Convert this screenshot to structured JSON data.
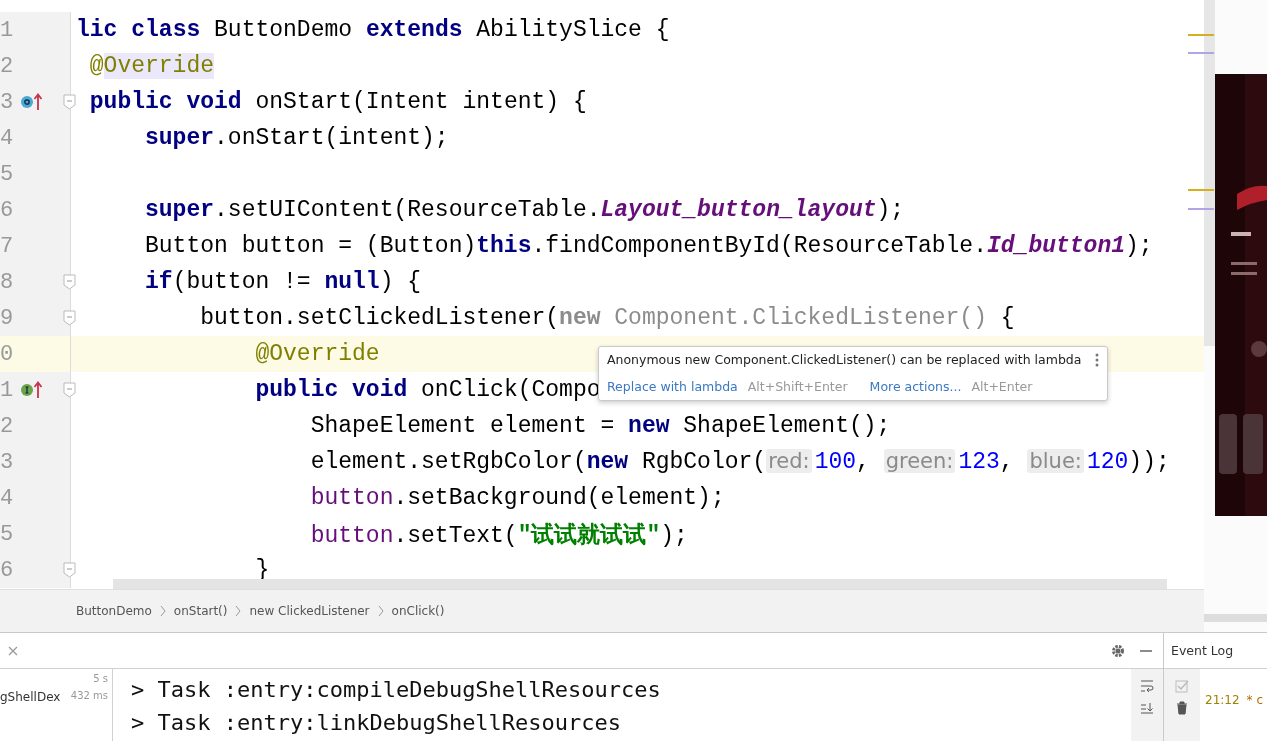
{
  "editor": {
    "lines": [
      {
        "number": "1",
        "kind": "plain",
        "fold": false,
        "current": false,
        "tokens": [
          {
            "t": "lic ",
            "kind": "kw"
          },
          {
            "t": "class ",
            "kind": "kw"
          },
          {
            "t": "ButtonDemo ",
            "kind": "plain"
          },
          {
            "t": "extends ",
            "kind": "kw"
          },
          {
            "t": "AbilitySlice {",
            "kind": "plain"
          }
        ]
      },
      {
        "number": "2",
        "kind": "plain",
        "fold": false,
        "current": false,
        "tokens": [
          {
            "t": " @",
            "kind": "annotation"
          },
          {
            "t": "Override",
            "kind": "annotation_hl"
          }
        ]
      },
      {
        "number": "3",
        "kind": "override",
        "fold": true,
        "current": false,
        "tokens": [
          {
            "t": " public void ",
            "kind": "kw"
          },
          {
            "t": "onStart(Intent intent) {",
            "kind": "plain"
          }
        ]
      },
      {
        "number": "4",
        "kind": "plain",
        "fold": false,
        "current": false,
        "tokens": [
          {
            "t": "     super",
            "kind": "kw"
          },
          {
            "t": ".onStart(intent);",
            "kind": "plain"
          }
        ]
      },
      {
        "number": "5",
        "kind": "plain",
        "fold": false,
        "current": false
      },
      {
        "number": "6",
        "kind": "plain",
        "fold": false,
        "current": false,
        "tokens": [
          {
            "t": "     super",
            "kind": "kw"
          },
          {
            "t": ".setUIContent(ResourceTable.",
            "kind": "plain"
          },
          {
            "t": "Layout_button_layout",
            "kind": "field"
          },
          {
            "t": ");",
            "kind": "plain"
          }
        ]
      },
      {
        "number": "7",
        "kind": "plain",
        "fold": false,
        "current": false,
        "tokens": [
          {
            "t": "     Button button = (Button)",
            "kind": "plain"
          },
          {
            "t": "this",
            "kind": "kw"
          },
          {
            "t": ".findComponentById(ResourceTable.",
            "kind": "plain"
          },
          {
            "t": "Id_button1",
            "kind": "field"
          },
          {
            "t": ");",
            "kind": "plain"
          }
        ]
      },
      {
        "number": "8",
        "kind": "plain",
        "fold": true,
        "current": false,
        "tokens": [
          {
            "t": "     if",
            "kind": "kw"
          },
          {
            "t": "(button != ",
            "kind": "plain"
          },
          {
            "t": "null",
            "kind": "kw"
          },
          {
            "t": ") {",
            "kind": "plain"
          }
        ]
      },
      {
        "number": "9",
        "kind": "plain",
        "fold": true,
        "current": false,
        "tokens": [
          {
            "t": "         button.setClickedListener(",
            "kind": "plain"
          },
          {
            "t": "new",
            "kind": "dimkw"
          },
          {
            "t": " Component.ClickedListener()",
            "kind": "dim"
          },
          {
            "t": " {",
            "kind": "plain"
          }
        ]
      },
      {
        "number": "0",
        "kind": "plain",
        "fold": false,
        "current": true,
        "tokens": [
          {
            "t": "             @Override",
            "kind": "annotation"
          }
        ]
      },
      {
        "number": "1",
        "kind": "implement",
        "fold": true,
        "current": false,
        "tokens": [
          {
            "t": "             public void ",
            "kind": "kw"
          },
          {
            "t": "onClick(Compo",
            "kind": "plain"
          }
        ]
      },
      {
        "number": "2",
        "kind": "plain",
        "fold": false,
        "current": false,
        "tokens": [
          {
            "t": "                 ShapeElement element = ",
            "kind": "plain"
          },
          {
            "t": "new ",
            "kind": "kw"
          },
          {
            "t": "ShapeElement();",
            "kind": "plain"
          }
        ]
      },
      {
        "number": "3",
        "kind": "plain",
        "fold": false,
        "current": false,
        "tokens": [
          {
            "t": "                 element.setRgbColor(",
            "kind": "plain"
          },
          {
            "t": "new ",
            "kind": "kw"
          },
          {
            "t": "RgbColor(",
            "kind": "plain"
          },
          {
            "t": "red:",
            "kind": "hint"
          },
          {
            "t": "100",
            "kind": "num"
          },
          {
            "t": ", ",
            "kind": "plain"
          },
          {
            "t": "green:",
            "kind": "hint"
          },
          {
            "t": "123",
            "kind": "num"
          },
          {
            "t": ", ",
            "kind": "plain"
          },
          {
            "t": "blue:",
            "kind": "hint"
          },
          {
            "t": "120",
            "kind": "num"
          },
          {
            "t": "));",
            "kind": "plain"
          }
        ]
      },
      {
        "number": "4",
        "kind": "plain",
        "fold": false,
        "current": false,
        "tokens": [
          {
            "t": "                 button",
            "kind": "var"
          },
          {
            "t": ".setBackground(element);",
            "kind": "plain"
          }
        ]
      },
      {
        "number": "5",
        "kind": "plain",
        "fold": false,
        "current": false,
        "tokens": [
          {
            "t": "                 button",
            "kind": "var"
          },
          {
            "t": ".setText(",
            "kind": "plain"
          },
          {
            "t": "\"试试就试试\"",
            "kind": "string"
          },
          {
            "t": ");",
            "kind": "plain"
          }
        ]
      },
      {
        "number": "6",
        "kind": "plain",
        "fold": true,
        "current": false,
        "tokens": [
          {
            "t": "             }",
            "kind": "plain"
          }
        ]
      }
    ]
  },
  "tooltip": {
    "message": "Anonymous new Component.ClickedListener() can be replaced with lambda",
    "actions": [
      {
        "label": "Replace with lambda",
        "shortcut": "Alt+Shift+Enter"
      },
      {
        "label": "More actions...",
        "shortcut": "Alt+Enter"
      }
    ]
  },
  "breadcrumbs": [
    "ButtonDemo",
    "onStart()",
    "new ClickedListener",
    "onClick()"
  ],
  "build": {
    "tree": [
      {
        "time": "5 s"
      },
      {
        "label": "gShellDex",
        "time": "432 ms"
      }
    ],
    "console": [
      "> Task :entry:compileDebugShellResources",
      "> Task :entry:linkDebugShellResources"
    ]
  },
  "event_log": {
    "title": "Event Log",
    "entries": [
      {
        "time": "21:12",
        "text": "* c"
      }
    ]
  }
}
